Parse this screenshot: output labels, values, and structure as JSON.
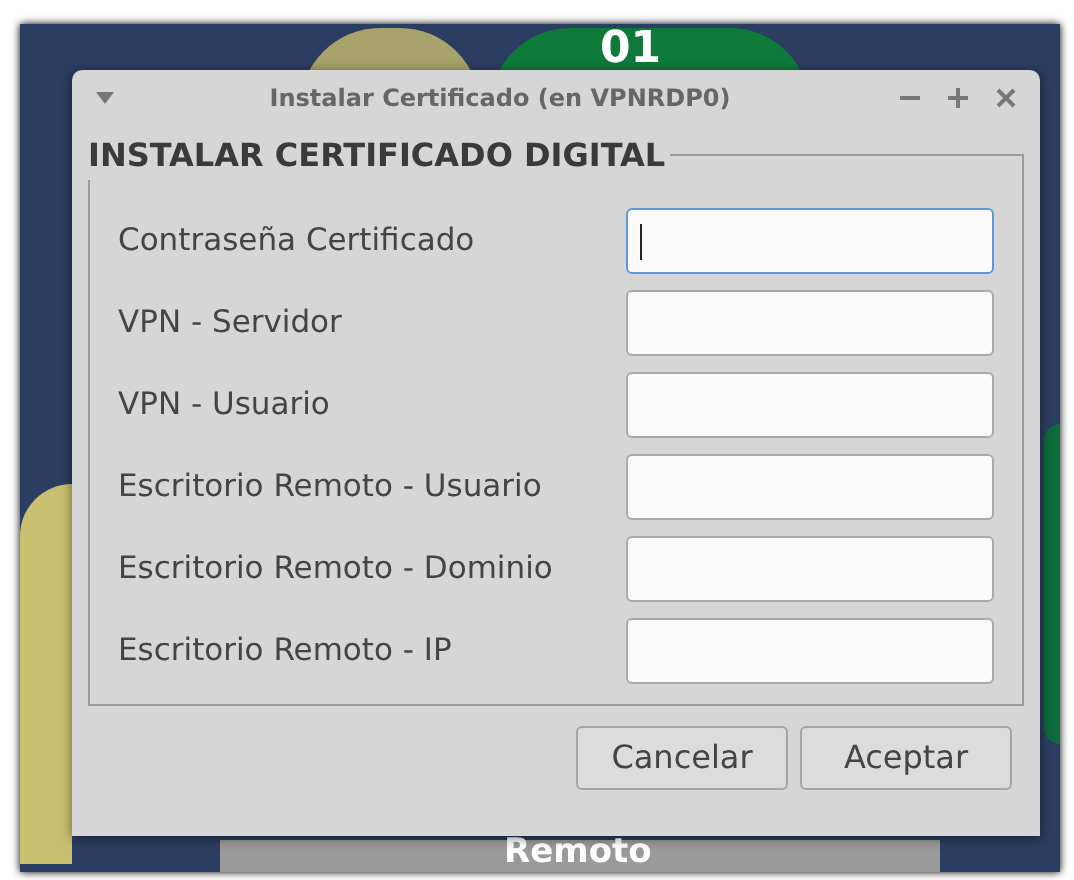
{
  "wallpaper": {
    "labels": [
      "01",
      "Remoto"
    ]
  },
  "window": {
    "title": "Instalar Certificado (en VPNRDP0)"
  },
  "group": {
    "title": "INSTALAR CERTIFICADO DIGITAL"
  },
  "fields": [
    {
      "label": "Contraseña Certificado",
      "focused": true
    },
    {
      "label": "VPN - Servidor",
      "focused": false
    },
    {
      "label": "VPN - Usuario",
      "focused": false
    },
    {
      "label": "Escritorio Remoto - Usuario",
      "focused": false
    },
    {
      "label": "Escritorio Remoto - Dominio",
      "focused": false
    },
    {
      "label": "Escritorio Remoto - IP",
      "focused": false
    }
  ],
  "buttons": [
    "Cancelar",
    "Aceptar"
  ]
}
